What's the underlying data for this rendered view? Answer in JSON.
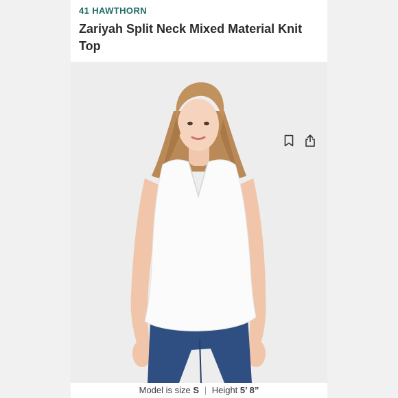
{
  "product": {
    "brand": "41 HAWTHORN",
    "title": "Zariyah Split Neck Mixed Material Knit Top"
  },
  "actions": {
    "bookmark_icon": "bookmark-icon",
    "share_icon": "share-icon"
  },
  "photo": {
    "subject": "model-photo"
  },
  "caption": {
    "size_prefix": "Model is size",
    "size_value": "S",
    "separator": "|",
    "height_prefix": "Height",
    "height_value": "5’ 8”"
  }
}
